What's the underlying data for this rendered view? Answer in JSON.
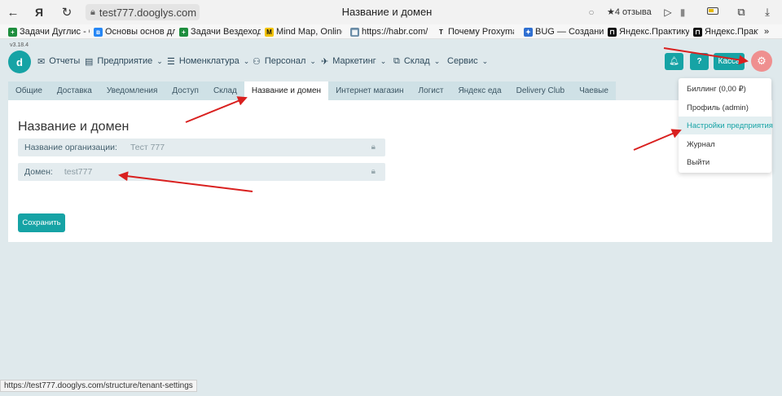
{
  "browser": {
    "url": "test777.dooglys.com",
    "title": "Название и домен",
    "reviews": "★4 отзыва",
    "status_url": "https://test777.dooglys.com/structure/tenant-settings"
  },
  "bookmarks": [
    {
      "label": "Задачи Дуглис - G",
      "icon": "sheets-icon",
      "color": "#1e8e3e"
    },
    {
      "label": "Основы основ для",
      "icon": "vk-icon",
      "color": "#2787f5"
    },
    {
      "label": "Задачи Вездеход",
      "icon": "sheets-icon",
      "color": "#1e8e3e"
    },
    {
      "label": "Mind Map, Online",
      "icon": "mindmap-icon",
      "color": "#222222"
    },
    {
      "label": "https://habr.com/",
      "icon": "habr-icon",
      "color": "#6a8ca6"
    },
    {
      "label": "Почему Proxyman",
      "icon": "text-icon",
      "color": "#222222"
    },
    {
      "label": "BUG — Создание",
      "icon": "bug-icon",
      "color": "#2f6fd1"
    },
    {
      "label": "Яндекс.Практикум",
      "icon": "practicum-icon",
      "color": "#111111"
    },
    {
      "label": "Яндекс.Практ",
      "icon": "practicum-icon",
      "color": "#111111"
    }
  ],
  "header": {
    "version": "v3.18.4",
    "nav": [
      {
        "label": "Отчеты",
        "icon": "reports-icon",
        "dropdown": false
      },
      {
        "label": "Предприятие",
        "icon": "enterprise-icon",
        "dropdown": true
      },
      {
        "label": "Номенклатура",
        "icon": "nomenclature-icon",
        "dropdown": true
      },
      {
        "label": "Персонал",
        "icon": "staff-icon",
        "dropdown": true
      },
      {
        "label": "Маркетинг",
        "icon": "marketing-icon",
        "dropdown": true
      },
      {
        "label": "Склад",
        "icon": "warehouse-icon",
        "dropdown": true
      },
      {
        "label": "Сервис",
        "icon": "",
        "dropdown": true
      }
    ],
    "kassa_label": "Касса",
    "help_label": "?"
  },
  "tabs": [
    {
      "label": "Общие",
      "active": false
    },
    {
      "label": "Доставка",
      "active": false
    },
    {
      "label": "Уведомления",
      "active": false
    },
    {
      "label": "Доступ",
      "active": false
    },
    {
      "label": "Склад",
      "active": false
    },
    {
      "label": "Название и домен",
      "active": true
    },
    {
      "label": "Интернет магазин",
      "active": false
    },
    {
      "label": "Логист",
      "active": false
    },
    {
      "label": "Яндекс еда",
      "active": false
    },
    {
      "label": "Delivery Club",
      "active": false
    },
    {
      "label": "Чаевые",
      "active": false
    }
  ],
  "form": {
    "title": "Название и домен",
    "org_label": "Название организации:",
    "org_value": "Тест 777",
    "domain_label": "Домен:",
    "domain_value": "test777",
    "save_label": "Сохранить"
  },
  "dropdown": {
    "items": [
      {
        "label": "Биллинг (0,00 ₽)",
        "active": false
      },
      {
        "label": "Профиль (admin)",
        "active": false
      },
      {
        "label": "Настройки предприятия",
        "active": true
      },
      {
        "label": "Журнал",
        "active": false
      },
      {
        "label": "Выйти",
        "active": false
      }
    ]
  },
  "colors": {
    "accent": "#16a3a5",
    "background": "#dfe9ec",
    "gear_button": "#ef8f8f",
    "annotation_arrow": "#d9201f"
  }
}
